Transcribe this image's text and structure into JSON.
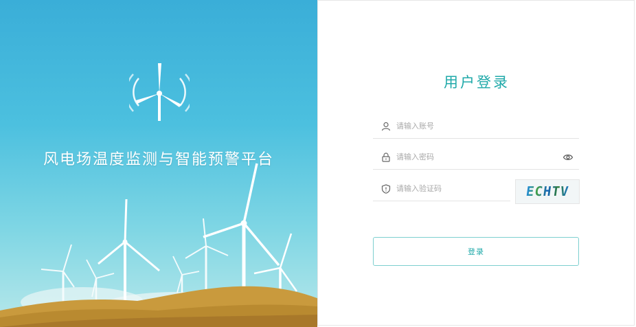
{
  "hero": {
    "title": "风电场温度监测与智能预警平台",
    "logo_icon": "wind-turbine-icon"
  },
  "login": {
    "title": "用户登录",
    "account": {
      "placeholder": "请输入账号",
      "value": "",
      "icon": "user-icon"
    },
    "password": {
      "placeholder": "请输入密码",
      "value": "",
      "icon": "lock-icon",
      "toggle_icon": "eye-icon"
    },
    "captcha_input": {
      "placeholder": "请输入验证码",
      "value": "",
      "icon": "shield-icon"
    },
    "captcha_code": "ECHTV",
    "submit_label": "登录"
  },
  "colors": {
    "accent": "#1fa9a9",
    "sky_top": "#3aaed8",
    "sky_bottom": "#b8e8ea",
    "hills": "#c99a3d"
  }
}
